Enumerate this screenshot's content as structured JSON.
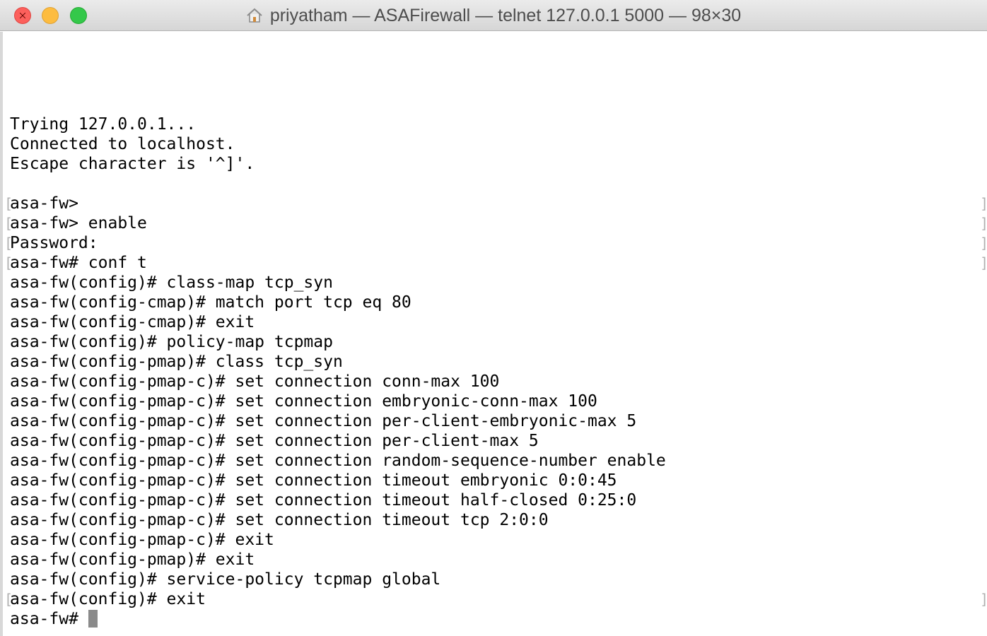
{
  "window": {
    "title": "priyatham — ASAFirewall — telnet 127.0.0.1 5000 — 98×30",
    "icon": "home-folder-icon"
  },
  "terminal": {
    "lines": [
      "Trying 127.0.0.1...",
      "Connected to localhost.",
      "Escape character is '^]'.",
      "",
      "asa-fw>",
      "asa-fw> enable",
      "Password:",
      "asa-fw# conf t",
      "asa-fw(config)# class-map tcp_syn",
      "asa-fw(config-cmap)# match port tcp eq 80",
      "asa-fw(config-cmap)# exit",
      "asa-fw(config)# policy-map tcpmap",
      "asa-fw(config-pmap)# class tcp_syn",
      "asa-fw(config-pmap-c)# set connection conn-max 100",
      "asa-fw(config-pmap-c)# set connection embryonic-conn-max 100",
      "asa-fw(config-pmap-c)# set connection per-client-embryonic-max 5",
      "asa-fw(config-pmap-c)# set connection per-client-max 5",
      "asa-fw(config-pmap-c)# set connection random-sequence-number enable",
      "asa-fw(config-pmap-c)# set connection timeout embryonic 0:0:45",
      "asa-fw(config-pmap-c)# set connection timeout half-closed 0:25:0",
      "asa-fw(config-pmap-c)# set connection timeout tcp 2:0:0",
      "asa-fw(config-pmap-c)# exit",
      "asa-fw(config-pmap)# exit",
      "asa-fw(config)# service-policy tcpmap global",
      "asa-fw(config)# exit"
    ],
    "prompt": "asa-fw#"
  },
  "colors": {
    "text": "#000000",
    "background": "#ffffff",
    "cursor": "#8a8a8a"
  }
}
